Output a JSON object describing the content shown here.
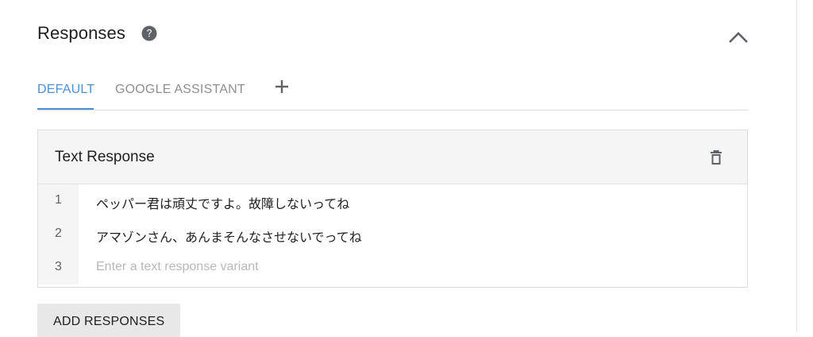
{
  "section": {
    "title": "Responses",
    "help_icon": "question-circle-icon",
    "collapse_icon": "chevron-up-icon"
  },
  "tabs": {
    "items": [
      {
        "label": "DEFAULT",
        "active": true
      },
      {
        "label": "GOOGLE ASSISTANT",
        "active": false
      }
    ],
    "add_icon": "plus-icon"
  },
  "card": {
    "title": "Text Response",
    "delete_icon": "trash-icon",
    "rows": [
      {
        "number": "1",
        "text": "ペッパー君は頑丈ですよ。故障しないってね"
      },
      {
        "number": "2",
        "text": "アマゾンさん、あんまそんなさせないでってね"
      }
    ],
    "input_row": {
      "number": "3",
      "value": "",
      "placeholder": "Enter a text response variant"
    }
  },
  "add_responses_label": "ADD RESPONSES",
  "colors": {
    "accent": "#4a90d9",
    "inactive_tab": "#8f8f8f",
    "placeholder": "#b8b8b8",
    "card_header_bg": "#f5f5f5",
    "button_bg": "#e8e8e8"
  }
}
